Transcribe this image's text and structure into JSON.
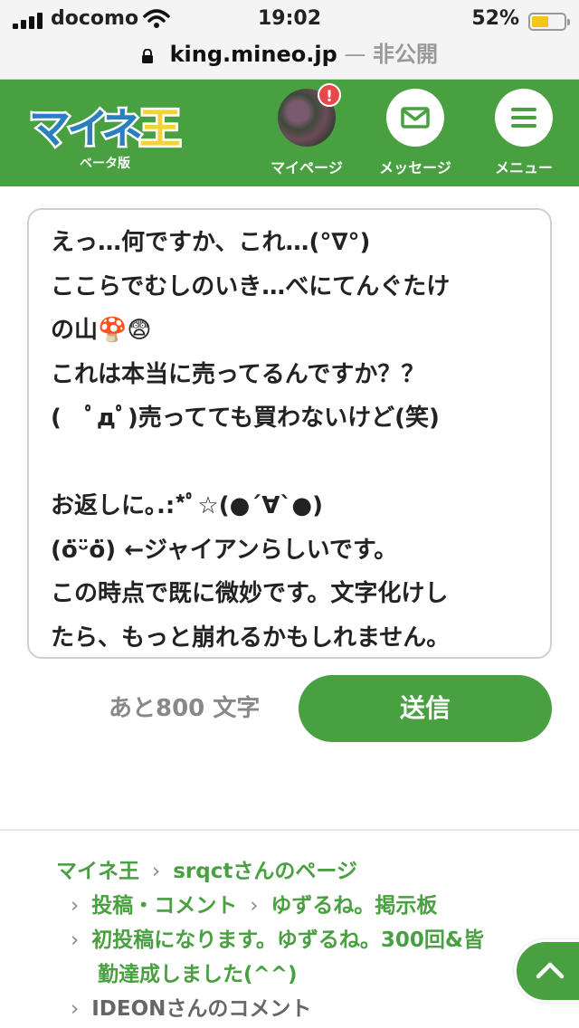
{
  "status_bar": {
    "carrier": "docomo",
    "time": "19:02",
    "battery": "52%",
    "battery_level": 0.52
  },
  "url_bar": {
    "host": "king.mineo.jp",
    "dash": "—",
    "visibility": "非公開"
  },
  "header": {
    "logo_text": "マイネ王",
    "logo_sub": "ベータ版",
    "nav": [
      {
        "label": "マイページ",
        "icon": "avatar",
        "badge": "!"
      },
      {
        "label": "メッセージ",
        "icon": "envelope-icon"
      },
      {
        "label": "メニュー",
        "icon": "hamburger-icon"
      }
    ],
    "color": "#48a041"
  },
  "editor": {
    "lines": [
      "えっ…何ですか、これ…(°∇°)",
      "ここらでむしのいき…べにてんぐたけ",
      "の山🍄😨",
      "これは本当に売ってるんですか？？",
      "(　ﾟдﾟ)売ってても買わないけど(笑)",
      "",
      "お返しに｡.:*ﾟ☆(●´∀`●)",
      "(ȯ̈ᵕ̈ȯ̈) ←ジャイアンらしいです。",
      "この時点で既に微妙です。文字化けし",
      "たら、もっと崩れるかもしれません。"
    ],
    "remaining": "あと800 文字",
    "send_label": "送信"
  },
  "breadcrumb": {
    "items": [
      {
        "label": "マイネ王"
      },
      {
        "label": "srqctさんのページ"
      },
      {
        "label": "投稿・コメント"
      },
      {
        "label": "ゆずるね。掲示板"
      },
      {
        "label": "初投稿になります。ゆずるね。300回&皆"
      },
      {
        "label": "勤達成しました(^^)"
      },
      {
        "label": "IDEONさんのコメント"
      }
    ],
    "separator": "›"
  }
}
